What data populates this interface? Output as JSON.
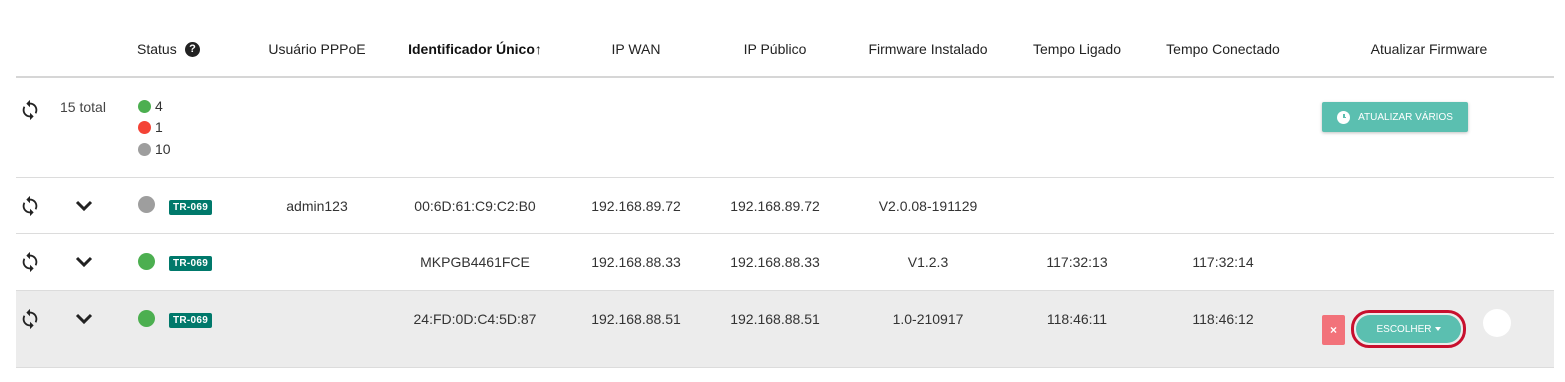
{
  "headers": {
    "status": "Status",
    "pppoe": "Usuário PPPoE",
    "identifier": "Identificador Único",
    "sort_arrow": "↑",
    "ip_wan": "IP WAN",
    "ip_public": "IP Público",
    "firmware": "Firmware Instalado",
    "uptime": "Tempo Ligado",
    "connected": "Tempo Conectado",
    "update_fw": "Atualizar Firmware",
    "help_icon": "?"
  },
  "summary": {
    "total": "15 total",
    "online": "4",
    "offline": "1",
    "unknown": "10",
    "update_many": "ATUALIZAR VÁRIOS"
  },
  "rows": [
    {
      "status": "grey",
      "protocol": "TR-069",
      "pppoe": "admin123",
      "identifier": "00:6D:61:C9:C2:B0",
      "ip_wan": "192.168.89.72",
      "ip_public": "192.168.89.72",
      "firmware": "V2.0.08-191129",
      "uptime": "",
      "connected": ""
    },
    {
      "status": "green",
      "protocol": "TR-069",
      "pppoe": "",
      "identifier": "MKPGB4461FCE",
      "ip_wan": "192.168.88.33",
      "ip_public": "192.168.88.33",
      "firmware": "V1.2.3",
      "uptime": "117:32:13",
      "connected": "117:32:14"
    },
    {
      "status": "green",
      "protocol": "TR-069",
      "pppoe": "",
      "identifier": "24:FD:0D:C4:5D:87",
      "ip_wan": "192.168.88.51",
      "ip_public": "192.168.88.51",
      "firmware": "1.0-210917",
      "uptime": "118:46:11",
      "connected": "118:46:12",
      "cancel_label": "×",
      "choose_label": "ESCOLHER"
    }
  ],
  "colors": {
    "online": "#4caf50",
    "offline": "#f44336",
    "unknown": "#9e9e9e",
    "badge": "#00796b",
    "accent": "#5bbfb0",
    "cancel": "#f2727a",
    "highlight": "#c8102e"
  }
}
